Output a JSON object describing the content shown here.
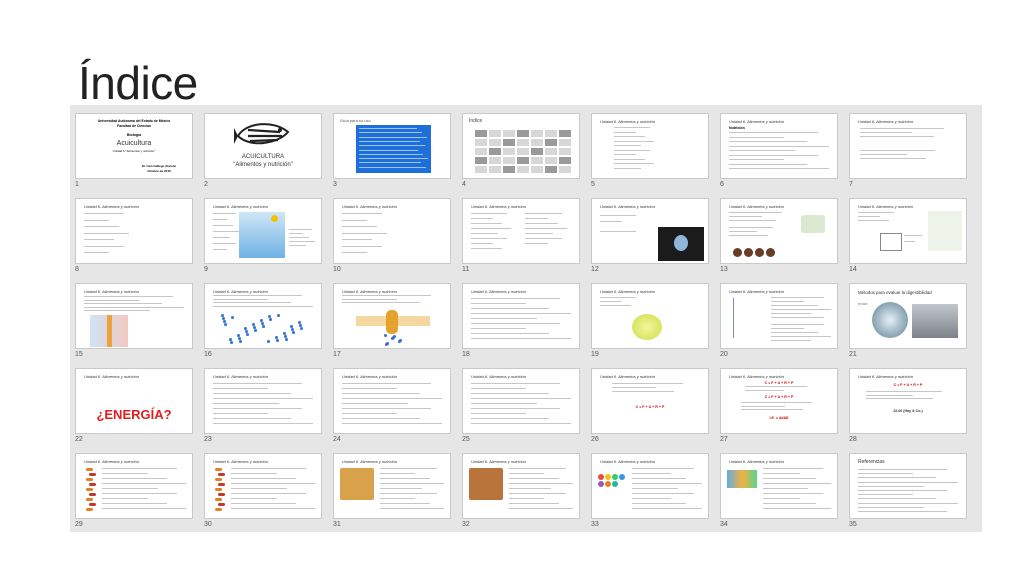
{
  "page": {
    "title": "Índice"
  },
  "slides": [
    {
      "num": "1",
      "kind": "cover",
      "lines": [
        "Universidad Autónoma del Estado de México",
        "Facultad de Ciencias",
        "Biología",
        "Acuicultura",
        "Unidad 6 \"Alimentos y nutrición\"",
        "Dr. Iván Gallego Alarcón",
        "Octubre de 2016"
      ]
    },
    {
      "num": "2",
      "kind": "logo",
      "lines": [
        "ACUICULTURA",
        "\"Alimentos y nutrición\""
      ]
    },
    {
      "num": "3",
      "kind": "guide",
      "lines": [
        "Guía para su uso"
      ]
    },
    {
      "num": "4",
      "kind": "grid",
      "lines": [
        "Índice"
      ]
    },
    {
      "num": "5",
      "kind": "text",
      "title": "Unidad 6. Alimentos y nutrición",
      "layout": "toc"
    },
    {
      "num": "6",
      "kind": "text",
      "title": "Unidad 6. Alimentos y nutrición",
      "layout": "nutrition",
      "lines": [
        "Nutrición"
      ]
    },
    {
      "num": "7",
      "kind": "text",
      "title": "Unidad 6. Alimentos y nutrición",
      "layout": "short"
    },
    {
      "num": "8",
      "kind": "text",
      "title": "Unidad 6. Alimentos y nutrición",
      "layout": "list"
    },
    {
      "num": "9",
      "kind": "diagram",
      "title": "Unidad 6. Alimentos y nutrición",
      "layout": "water"
    },
    {
      "num": "10",
      "kind": "text",
      "title": "Unidad 6. Alimentos y nutrición",
      "layout": "list"
    },
    {
      "num": "11",
      "kind": "text",
      "title": "Unidad 6. Alimentos y nutrición",
      "layout": "twocol"
    },
    {
      "num": "12",
      "kind": "diagram",
      "title": "Unidad 6. Alimentos y nutrición",
      "layout": "photo-dark"
    },
    {
      "num": "13",
      "kind": "diagram",
      "title": "Unidad 6. Alimentos y nutrición",
      "layout": "circles"
    },
    {
      "num": "14",
      "kind": "diagram",
      "title": "Unidad 6. Alimentos y nutrición",
      "layout": "flow"
    },
    {
      "num": "15",
      "kind": "diagram",
      "title": "Unidad 6. Alimentos y nutrición",
      "layout": "membrane"
    },
    {
      "num": "16",
      "kind": "diagram",
      "title": "Unidad 6. Alimentos y nutrición",
      "layout": "dots"
    },
    {
      "num": "17",
      "kind": "diagram",
      "title": "Unidad 6. Alimentos y nutrición",
      "layout": "channel"
    },
    {
      "num": "18",
      "kind": "text",
      "title": "Unidad 6. Alimentos y nutrición",
      "layout": "para"
    },
    {
      "num": "19",
      "kind": "diagram",
      "title": "Unidad 6. Alimentos y nutrición",
      "layout": "cell"
    },
    {
      "num": "20",
      "kind": "text",
      "title": "Unidad 6. Alimentos y nutrición",
      "layout": "digest"
    },
    {
      "num": "21",
      "kind": "photo",
      "lines": [
        "Métodos para evaluar la digestibilidad",
        "In vivo"
      ]
    },
    {
      "num": "22",
      "kind": "energy",
      "title": "Unidad 6. Alimentos y nutrición",
      "lines": [
        "¿ENERGÍA?"
      ]
    },
    {
      "num": "23",
      "kind": "text",
      "title": "Unidad 6. Alimentos y nutrición",
      "layout": "para"
    },
    {
      "num": "24",
      "kind": "text",
      "title": "Unidad 6. Alimentos y nutrición",
      "layout": "para"
    },
    {
      "num": "25",
      "kind": "text",
      "title": "Unidad 6. Alimentos y nutrición",
      "layout": "para"
    },
    {
      "num": "26",
      "kind": "equation",
      "title": "Unidad 6. Alimentos y nutrición",
      "lines": [
        "C = F + U + R + P"
      ]
    },
    {
      "num": "27",
      "kind": "equation2",
      "title": "Unidad 6. Alimentos y nutrición",
      "lines": [
        "C = F + U + R + P",
        "C = F + U + R + P",
        "I.E. = ΔI/ΔE"
      ]
    },
    {
      "num": "28",
      "kind": "equation3",
      "title": "Unidad 6. Alimentos y nutrición",
      "lines": [
        "C = F + U + R + P",
        "22.06 (Hay & Co.)"
      ]
    },
    {
      "num": "29",
      "kind": "dna",
      "title": "Unidad 6. Alimentos y nutrición"
    },
    {
      "num": "30",
      "kind": "dna",
      "title": "Unidad 6. Alimentos y nutrición"
    },
    {
      "num": "31",
      "kind": "food",
      "title": "Unidad 6. Alimentos y nutrición",
      "tone": "#d8a24a"
    },
    {
      "num": "32",
      "kind": "food",
      "title": "Unidad 6. Alimentos y nutrición",
      "tone": "#b8743a"
    },
    {
      "num": "33",
      "kind": "balls",
      "title": "Unidad 6. Alimentos y nutrición"
    },
    {
      "num": "34",
      "kind": "pills",
      "title": "Unidad 6. Alimentos y nutrición"
    },
    {
      "num": "35",
      "kind": "refs",
      "lines": [
        "Referencias"
      ]
    }
  ]
}
